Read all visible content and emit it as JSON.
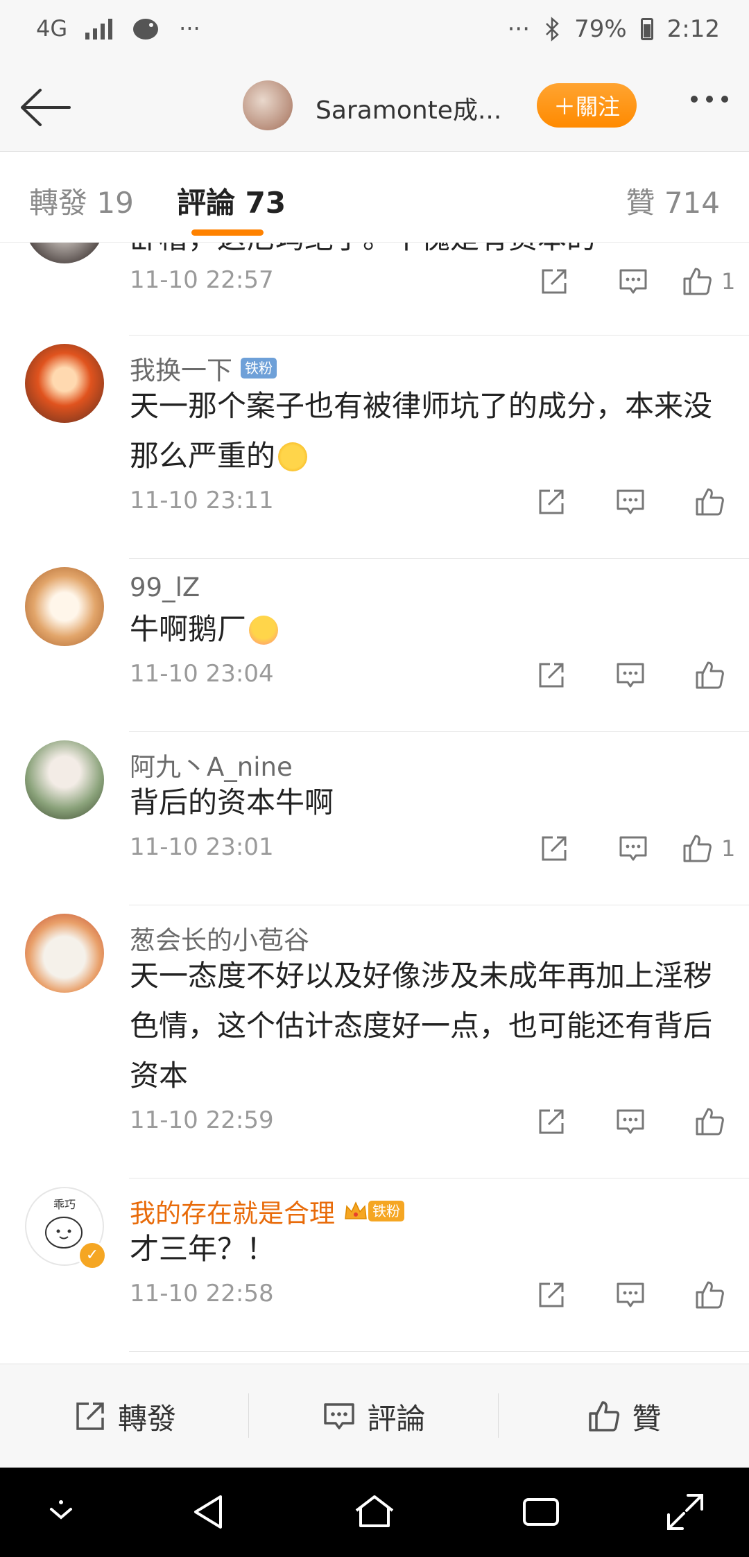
{
  "status_bar": {
    "network": "4G",
    "dots_left": "···",
    "dots_right": "···",
    "battery": "79%",
    "time": "2:12"
  },
  "header": {
    "title": "Saramonte成...",
    "follow_label": "＋關注"
  },
  "tabs": [
    {
      "label": "轉發 19"
    },
    {
      "label": "評論 73"
    },
    {
      "label": "贊 714"
    }
  ],
  "comments": [
    {
      "name": "",
      "text": "卧槽，这尼玛绝了。不愧是有资本的",
      "time": "11-10 22:57",
      "likes": "1"
    },
    {
      "name": "我换一下",
      "badge": "铁粉",
      "text": "天一那个案子也有被律师坑了的成分，本来没那么严重的",
      "time": "11-10 23:11",
      "likes": ""
    },
    {
      "name": "99_lZ",
      "text": "牛啊鹅厂",
      "time": "11-10 23:04",
      "likes": ""
    },
    {
      "name": "阿九丶A_nine",
      "text": "背后的资本牛啊",
      "time": "11-10 23:01",
      "likes": "1"
    },
    {
      "name": "葱会长的小苞谷",
      "text": "天一态度不好以及好像涉及未成年再加上淫秽色情，这个估计态度好一点，也可能还有背后资本",
      "time": "11-10 22:59",
      "likes": ""
    },
    {
      "name": "我的存在就是合理",
      "badge": "铁粉",
      "avatar_text": "乖巧",
      "text": "才三年？！",
      "time": "11-10 22:58",
      "likes": ""
    }
  ],
  "bottom_bar": {
    "repost": "轉發",
    "comment": "評論",
    "like": "贊"
  },
  "colors": {
    "accent": "#ff8200",
    "vip_name": "#e86b0a"
  }
}
